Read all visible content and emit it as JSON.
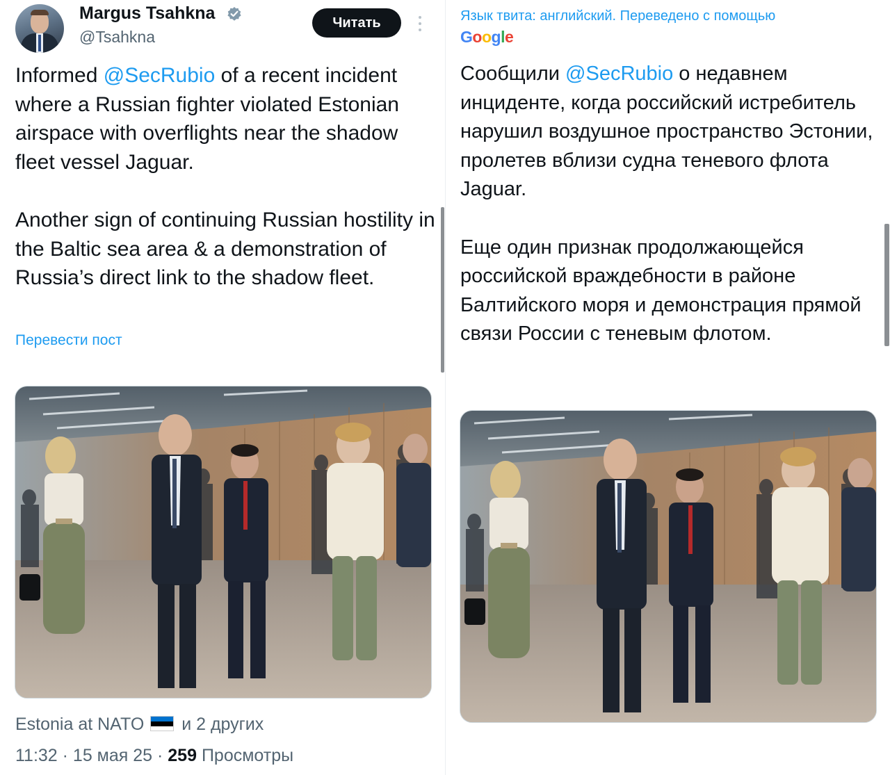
{
  "original_tweet": {
    "author_name": "Margus Tsahkna",
    "author_handle": "@Tsahkna",
    "follow_label": "Читать",
    "paragraph1_before": "Informed ",
    "mention": "@SecRubio",
    "paragraph1_after": " of a recent incident where a Russian fighter violated Estonian airspace with overflights near the shadow fleet vessel Jaguar.",
    "paragraph2": "Another sign of continuing Russian hostility in the Baltic sea area & a demonstration of Russia’s direct link to the shadow fleet.",
    "translate_link": "Перевести пост",
    "tagged_account": "Estonia at NATO",
    "tagged_others": "и 2 других",
    "timestamp": "11:32 · 15 мая 25 · ",
    "views_count": "259",
    "views_label": " Просмотры"
  },
  "translation": {
    "note": "Язык твита: английский. Переведено с помощью",
    "provider": [
      "G",
      "o",
      "o",
      "g",
      "l",
      "e"
    ],
    "paragraph1_before": "Сообщили ",
    "mention": "@SecRubio",
    "paragraph1_after": " о недавнем инциденте, когда российский истребитель нарушил воздушное пространство Эстонии, пролетев вблизи судна теневого флота Jaguar.",
    "paragraph2": "Еще один признак продолжающейся российской враждебности в районе Балтийского моря и демонстрация прямой связи России с теневым флотом."
  },
  "icons": {
    "verified": "verified-badge-icon",
    "more": "more-options-icon",
    "flag": "estonia-flag-icon"
  },
  "colors": {
    "link_blue": "#1d9bf0",
    "text": "#0f1419",
    "muted": "#536471",
    "button_bg": "#0f1419",
    "flag": [
      "#0072ce",
      "#000000",
      "#ffffff"
    ]
  }
}
